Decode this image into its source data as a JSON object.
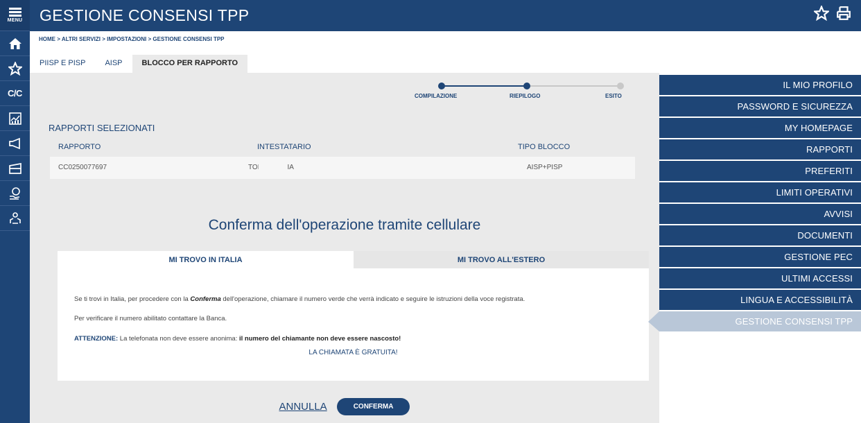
{
  "rail": {
    "menu_label": "MENU",
    "cc_label": "C/C",
    "items": [
      {
        "icon": "home-icon",
        "glyph": "🏠"
      },
      {
        "icon": "star-icon",
        "glyph": "☆"
      },
      {
        "icon": "cc-icon"
      },
      {
        "icon": "chart-icon",
        "glyph": "📊"
      },
      {
        "icon": "megaphone-icon",
        "glyph": "📢"
      },
      {
        "icon": "folder-icon",
        "glyph": "🗂"
      },
      {
        "icon": "coins-hand-icon",
        "glyph": "💰"
      },
      {
        "icon": "people-icon",
        "glyph": "👥"
      }
    ]
  },
  "header": {
    "title": "GESTIONE CONSENSI TPP",
    "icons": [
      "star-outline-icon",
      "print-icon"
    ]
  },
  "breadcrumb": "HOME > ALTRI SERVIZI > IMPOSTAZIONI > GESTIONE CONSENSI TPP",
  "tabs": [
    {
      "label": "PIISP E PISP",
      "active": false
    },
    {
      "label": "AISP",
      "active": false
    },
    {
      "label": "BLOCCO PER RAPPORTO",
      "active": true
    }
  ],
  "stepper": {
    "steps": [
      {
        "label": "COMPILAZIONE",
        "state": "done"
      },
      {
        "label": "RIEPILOGO",
        "state": "current"
      },
      {
        "label": "ESITO",
        "state": "todo"
      }
    ]
  },
  "rapporti": {
    "title": "RAPPORTI SELEZIONATI",
    "columns": [
      "RAPPORTO",
      "INTESTATARIO",
      "TIPO BLOCCO"
    ],
    "rows": [
      {
        "rapporto": "CC0250077697",
        "intestatario": "TOE          ILIA",
        "tipo_blocco": "AISP+PISP"
      }
    ]
  },
  "conferma": {
    "title": "Conferma dell'operazione tramite cellulare",
    "tab_italia": "MI TROVO IN ITALIA",
    "tab_estero": "MI TROVO ALL'ESTERO",
    "p1_before": "Se ti trovi in Italia, per procedere con la ",
    "p1_bold": "Conferma",
    "p1_after": " dell'operazione, chiamare il numero verde che verrà indicato e seguire le istruzioni della voce registrata.",
    "p2": "Per verificare il numero abilitato contattare la Banca.",
    "warn_label": "ATTENZIONE:",
    "warn_text": " La telefonata non deve essere anonima: ",
    "warn_bold": "il numero del chiamante non deve essere nascosto!",
    "free": "LA CHIAMATA È GRATUITA!"
  },
  "actions": {
    "annulla": "ANNULLA",
    "conferma": "CONFERMA"
  },
  "right_menu": [
    {
      "label": "IL MIO PROFILO",
      "active": false
    },
    {
      "label": "PASSWORD E SICUREZZA",
      "active": false
    },
    {
      "label": "MY HOMEPAGE",
      "active": false
    },
    {
      "label": "RAPPORTI",
      "active": false
    },
    {
      "label": "PREFERITI",
      "active": false
    },
    {
      "label": "LIMITI OPERATIVI",
      "active": false
    },
    {
      "label": "AVVISI",
      "active": false
    },
    {
      "label": "DOCUMENTI",
      "active": false
    },
    {
      "label": "GESTIONE PEC",
      "active": false
    },
    {
      "label": "ULTIMI ACCESSI",
      "active": false
    },
    {
      "label": "LINGUA E ACCESSIBILITÀ",
      "active": false
    },
    {
      "label": "GESTIONE CONSENSI TPP",
      "active": true
    }
  ],
  "colors": {
    "brand": "#1e4576",
    "step_todo": "#c8c8c8",
    "menu_active": "#b9c7d8"
  }
}
